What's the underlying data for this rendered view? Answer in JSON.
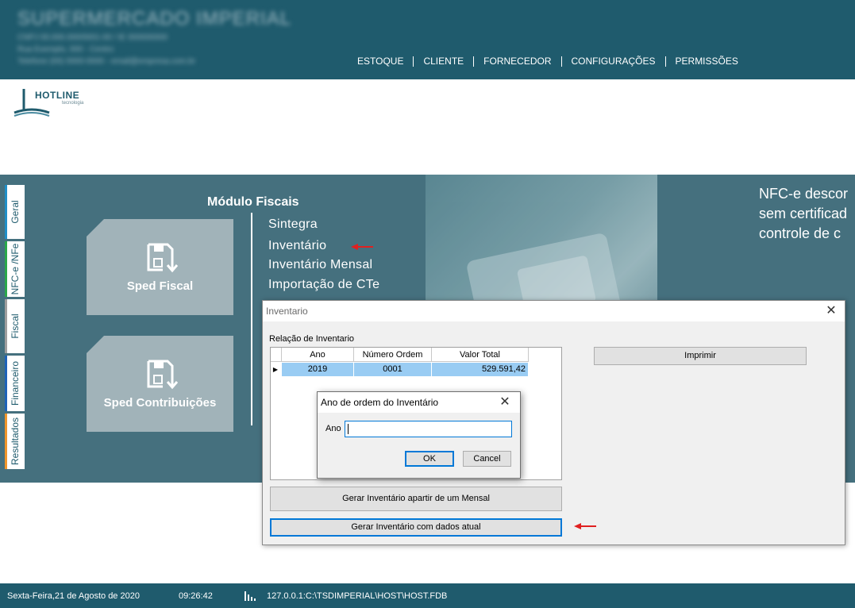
{
  "header": {
    "company_name": "SUPERMERCADO IMPERIAL",
    "company_lines": [
      "CNPJ 00.000.000/0001-00 / IE 000000000",
      "Rua Exemplo, 000 - Centro",
      "Telefone (00) 0000-0000 - email@empresa.com.br"
    ],
    "nav": [
      "ESTOQUE",
      "CLIENTE",
      "FORNECEDOR",
      "CONFIGURAÇÕES",
      "PERMISSÕES"
    ]
  },
  "logo": {
    "name": "HOTLINE",
    "tagline": "tecnologia"
  },
  "side_tabs": [
    {
      "label": "Geral",
      "color": "#1f8fc7"
    },
    {
      "label": "NFC-e /NFe",
      "color": "#2aa84a"
    },
    {
      "label": "Fiscal",
      "color": "#9e9e9e"
    },
    {
      "label": "Financeiro",
      "color": "#1e63b8"
    },
    {
      "label": "Resultados",
      "color": "#f0962a"
    }
  ],
  "module": {
    "title": "Módulo Fiscais",
    "cards": [
      "Sped Fiscal",
      "Sped Contribuições"
    ],
    "links": [
      "Sintegra",
      "Inventário",
      "Inventário Mensal",
      "Importação de CTe"
    ]
  },
  "promo": {
    "lines": [
      "NFC-e descor",
      "sem certificad",
      "controle de c"
    ]
  },
  "inventory_window": {
    "title": "Inventario",
    "list_label": "Relação de Inventario",
    "columns": [
      "Ano",
      "Número Ordem",
      "Valor Total"
    ],
    "rows": [
      {
        "ano": "2019",
        "ordem": "0001",
        "valor": "529.591,42"
      }
    ],
    "print_button": "Imprimir",
    "gen_from_monthly_button": "Gerar Inventário apartir de um Mensal",
    "gen_current_button": "Gerar Inventário com dados atual"
  },
  "year_dialog": {
    "title": "Ano de ordem do Inventário",
    "field_label": "Ano",
    "field_value": "",
    "ok_button": "OK",
    "cancel_button": "Cancel"
  },
  "status_bar": {
    "date": "Sexta-Feira,21 de Agosto de 2020",
    "time": "09:26:42",
    "db_path": "127.0.0.1:C:\\TSDIMPERIAL\\HOST\\HOST.FDB"
  },
  "colors": {
    "brand": "#1f5b6d",
    "band": "#45707e",
    "card": "#a1b3b9",
    "selection": "#99ccf3",
    "annotation_arrow": "#e02020"
  }
}
